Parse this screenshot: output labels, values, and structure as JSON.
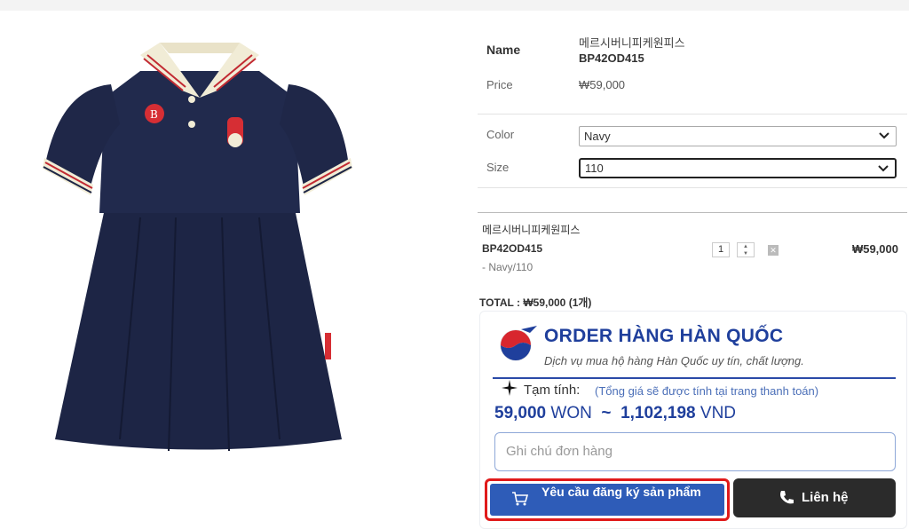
{
  "product": {
    "name_label": "Name",
    "name_line1": "메르시버니피케원피스",
    "name_line2": "BP42OD415",
    "price_label": "Price",
    "price_value": "₩59,000",
    "color_label": "Color",
    "color_value": "Navy",
    "size_label": "Size",
    "size_value": "110",
    "image_icon": "navy-polo-dress-image"
  },
  "cart": {
    "item_name": "메르시버니피케원피스",
    "item_code": "BP42OD415",
    "item_option": "- Navy/110",
    "quantity": "1",
    "item_price": "₩59,000",
    "total": "TOTAL : ₩59,000 (1개)"
  },
  "order_widget": {
    "brand_title": "ORDER HÀNG HÀN QUỐC",
    "brand_subtitle": "Dịch vụ mua hộ hàng Hàn Quốc uy tín, chất lượng.",
    "tam_tinh_label": "Tạm tính:",
    "tam_tinh_note": "(Tổng giá sẽ được tính tại trang thanh toán)",
    "price_won": "59,000",
    "won_unit": "WON",
    "tilde": "~",
    "price_vnd": "1,102,198",
    "vnd_unit": "VND",
    "note_placeholder": "Ghi chú đơn hàng",
    "request_button": "Yêu cầu đăng ký sản phẩm",
    "contact_button": "Liên hệ",
    "accent_color": "#1f3f9c",
    "highlight_color": "#e01a1a"
  }
}
